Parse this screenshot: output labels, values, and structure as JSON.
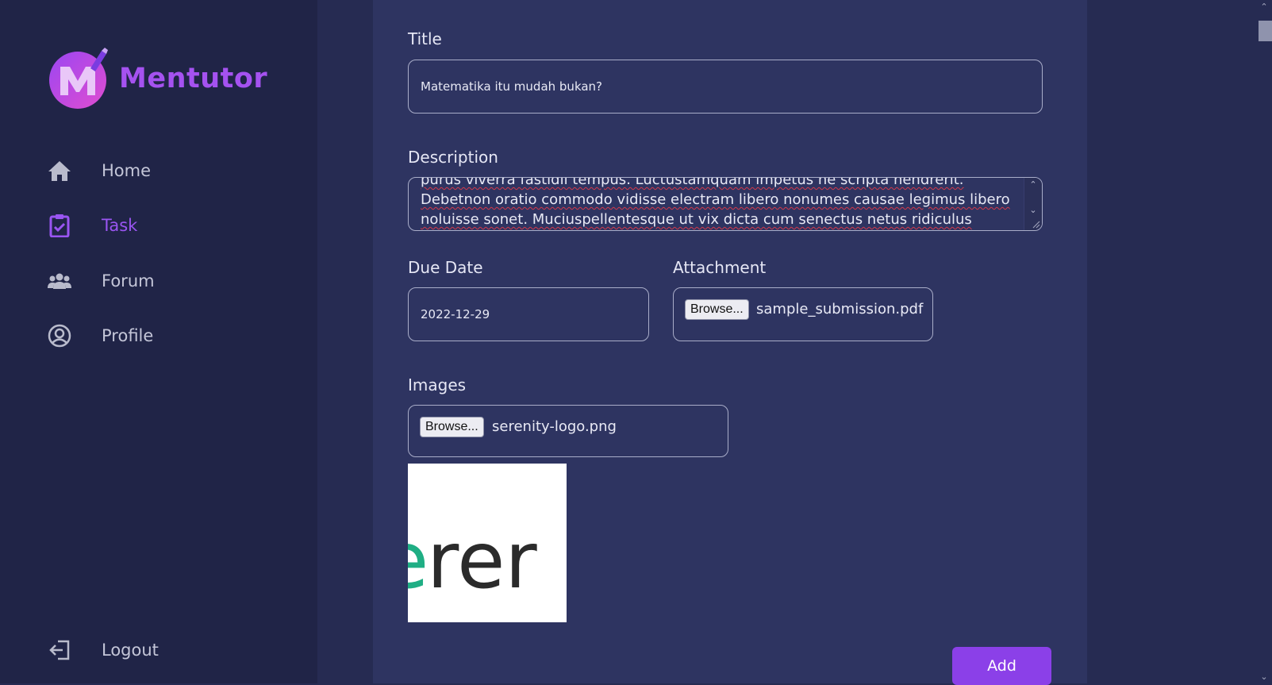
{
  "app": {
    "name": "Mentutor",
    "brand_color": "#a552f0",
    "accent_color": "#8b40e8"
  },
  "sidebar": {
    "items": [
      {
        "label": "Home",
        "icon": "home-icon",
        "active": false
      },
      {
        "label": "Task",
        "icon": "task-clipboard-icon",
        "active": true
      },
      {
        "label": "Forum",
        "icon": "users-group-icon",
        "active": false
      },
      {
        "label": "Profile",
        "icon": "user-circle-icon",
        "active": false
      }
    ],
    "logout_label": "Logout"
  },
  "form": {
    "title_label": "Title",
    "title_value": "Matematika itu mudah bukan?",
    "description_label": "Description",
    "description_value": "purus viverra fastidii tempus.  Luctustamquam impetus ne scripta hendrerit. Debetnon oratio commodo vidisse electram libero nonumes causae legimus libero noluisse sonet.  Muciuspellentesque ut vix dicta cum senectus netus ridiculus iudicabit.",
    "due_date_label": "Due Date",
    "due_date_value": "2022-12-29",
    "attachment_label": "Attachment",
    "attachment_button": "Browse...",
    "attachment_file": "sample_submission.pdf",
    "images_label": "Images",
    "images_button": "Browse...",
    "images_file": "serenity-logo.png",
    "submit_label": "Add"
  }
}
